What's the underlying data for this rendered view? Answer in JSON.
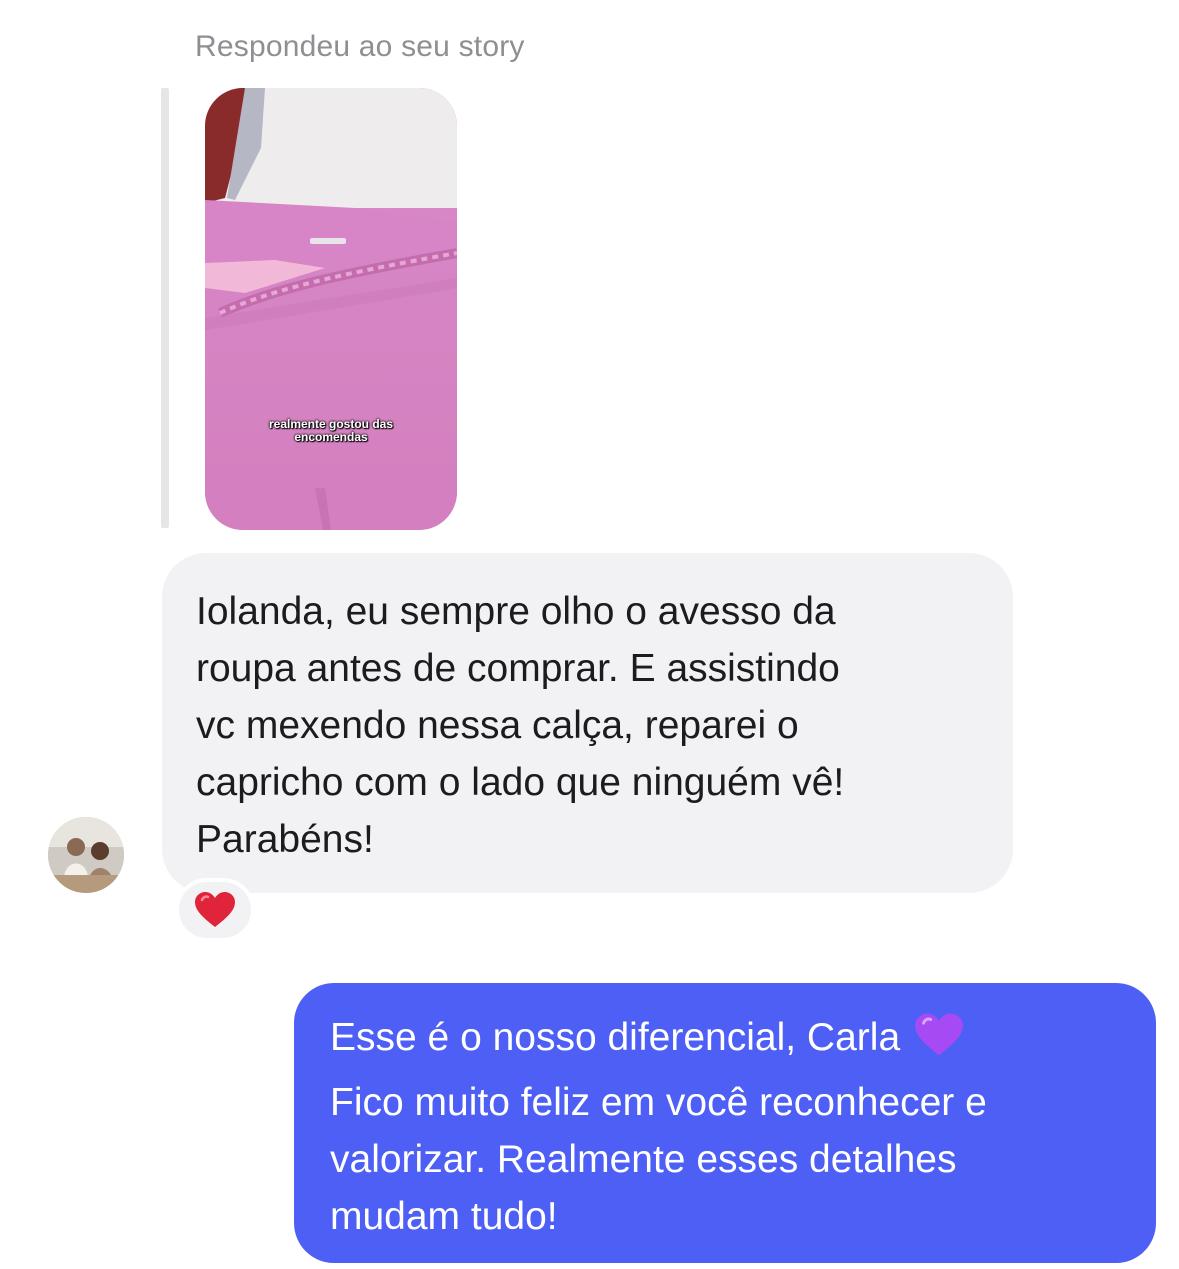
{
  "reply_label": "Respondeu ao seu story",
  "story": {
    "caption_line1": "realmente gostou das",
    "caption_line2": "encomendas"
  },
  "incoming_message": {
    "text": "Iolanda, eu sempre olho o avesso da\nroupa antes de comprar. E assistindo\nvc mexendo nessa calça, reparei o\ncapricho com o lado que ninguém vê!\nParabéns!",
    "reaction_icon": "red-heart-icon"
  },
  "outgoing_message": {
    "line1": "Esse é o nosso diferencial, Carla",
    "line2": "Fico muito feliz em você reconhecer e",
    "line3": "valorizar. Realmente esses detalhes",
    "line4": "mudam tudo!",
    "emoji_icon": "purple-heart-icon"
  },
  "colors": {
    "incoming_bubble": "#f2f2f5",
    "outgoing_bubble": "#4d5ff5",
    "meta_text": "#8e8e93",
    "reaction_heart": "#e0243a",
    "purple_heart": "#a64bf4"
  }
}
